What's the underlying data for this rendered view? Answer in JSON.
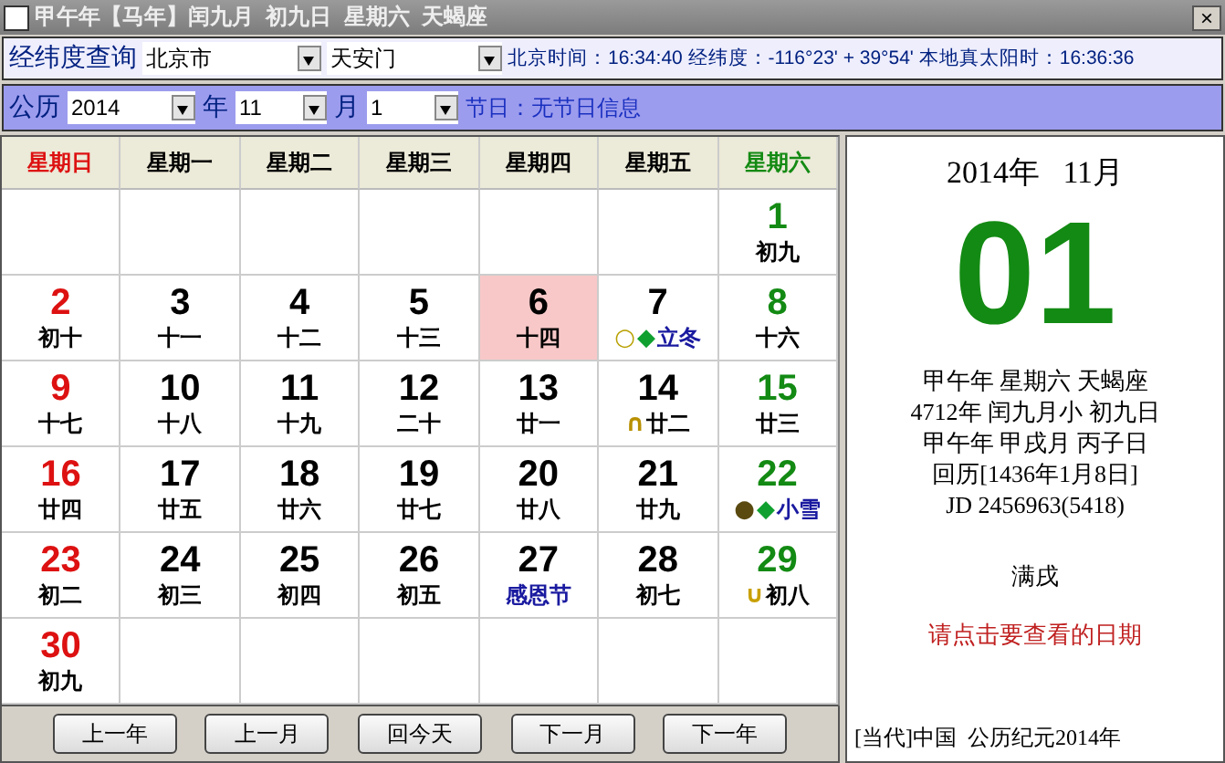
{
  "window": {
    "title": "甲午年【马年】闰九月  初九日  星期六  天蝎座",
    "close": "×"
  },
  "location": {
    "label": "经纬度查询",
    "city": "北京市",
    "place": "天安门",
    "info": "北京时间：16:34:40 经纬度：-116°23' + 39°54' 本地真太阳时：16:36:36"
  },
  "date_bar": {
    "label": "公历",
    "year": "2014",
    "year_unit": "年",
    "month": "11",
    "month_unit": "月",
    "day": "1",
    "holiday": "节日：无节日信息"
  },
  "weekdays": [
    "星期日",
    "星期一",
    "星期二",
    "星期三",
    "星期四",
    "星期五",
    "星期六"
  ],
  "weeks": [
    [
      {
        "day": "1",
        "lunar": "初九",
        "selected": false,
        "kind": "lunar"
      }
    ],
    [
      {
        "day": "2",
        "lunar": "初十",
        "selected": false,
        "kind": "lunar"
      },
      {
        "day": "3",
        "lunar": "十一",
        "selected": false,
        "kind": "lunar"
      },
      {
        "day": "4",
        "lunar": "十二",
        "selected": false,
        "kind": "lunar"
      },
      {
        "day": "5",
        "lunar": "十三",
        "selected": false,
        "kind": "lunar"
      },
      {
        "day": "6",
        "lunar": "十四",
        "selected": true,
        "kind": "lunar"
      },
      {
        "day": "7",
        "lunar": "立冬",
        "selected": false,
        "kind": "term",
        "marks": [
          {
            "symbol": "○",
            "color": "#b8a000"
          },
          {
            "symbol": "◆",
            "color": "#10a030"
          }
        ]
      },
      {
        "day": "8",
        "lunar": "十六",
        "selected": false,
        "kind": "lunar"
      }
    ],
    [
      {
        "day": "9",
        "lunar": "十七",
        "selected": false,
        "kind": "lunar"
      },
      {
        "day": "10",
        "lunar": "十八",
        "selected": false,
        "kind": "lunar"
      },
      {
        "day": "11",
        "lunar": "十九",
        "selected": false,
        "kind": "lunar"
      },
      {
        "day": "12",
        "lunar": "二十",
        "selected": false,
        "kind": "lunar"
      },
      {
        "day": "13",
        "lunar": "廿一",
        "selected": false,
        "kind": "lunar"
      },
      {
        "day": "14",
        "lunar": "廿二",
        "selected": false,
        "kind": "lunar",
        "marks": [
          {
            "symbol": "∩",
            "color": "#b89000"
          }
        ]
      },
      {
        "day": "15",
        "lunar": "廿三",
        "selected": false,
        "kind": "lunar"
      }
    ],
    [
      {
        "day": "16",
        "lunar": "廿四",
        "selected": false,
        "kind": "lunar"
      },
      {
        "day": "17",
        "lunar": "廿五",
        "selected": false,
        "kind": "lunar"
      },
      {
        "day": "18",
        "lunar": "廿六",
        "selected": false,
        "kind": "lunar"
      },
      {
        "day": "19",
        "lunar": "廿七",
        "selected": false,
        "kind": "lunar"
      },
      {
        "day": "20",
        "lunar": "廿八",
        "selected": false,
        "kind": "lunar"
      },
      {
        "day": "21",
        "lunar": "廿九",
        "selected": false,
        "kind": "lunar"
      },
      {
        "day": "22",
        "lunar": "小雪",
        "selected": false,
        "kind": "term",
        "marks": [
          {
            "symbol": "●",
            "color": "#5a4a10"
          },
          {
            "symbol": "◆",
            "color": "#10a030"
          }
        ]
      }
    ],
    [
      {
        "day": "23",
        "lunar": "初二",
        "selected": false,
        "kind": "lunar"
      },
      {
        "day": "24",
        "lunar": "初三",
        "selected": false,
        "kind": "lunar"
      },
      {
        "day": "25",
        "lunar": "初四",
        "selected": false,
        "kind": "lunar"
      },
      {
        "day": "26",
        "lunar": "初五",
        "selected": false,
        "kind": "lunar"
      },
      {
        "day": "27",
        "lunar": "感恩节",
        "selected": false,
        "kind": "festival"
      },
      {
        "day": "28",
        "lunar": "初七",
        "selected": false,
        "kind": "lunar"
      },
      {
        "day": "29",
        "lunar": "初八",
        "selected": false,
        "kind": "lunar",
        "marks": [
          {
            "symbol": "∪",
            "color": "#c8a000"
          }
        ]
      }
    ],
    [
      {
        "day": "30",
        "lunar": "初九",
        "selected": false,
        "kind": "lunar"
      }
    ]
  ],
  "buttons": [
    "上一年",
    "上一月",
    "回今天",
    "下一月",
    "下一年"
  ],
  "detail": {
    "year_month": "2014年   11月",
    "big_day": "01",
    "lines": [
      "甲午年 星期六 天蝎座",
      "4712年 闰九月小 初九日",
      "甲午年 甲戌月 丙子日",
      "回历[1436年1月8日]",
      "JD 2456963(5418)"
    ],
    "duty": "满戌",
    "hint": "请点击要查看的日期",
    "footer": "[当代]中国  公历纪元2014年"
  }
}
